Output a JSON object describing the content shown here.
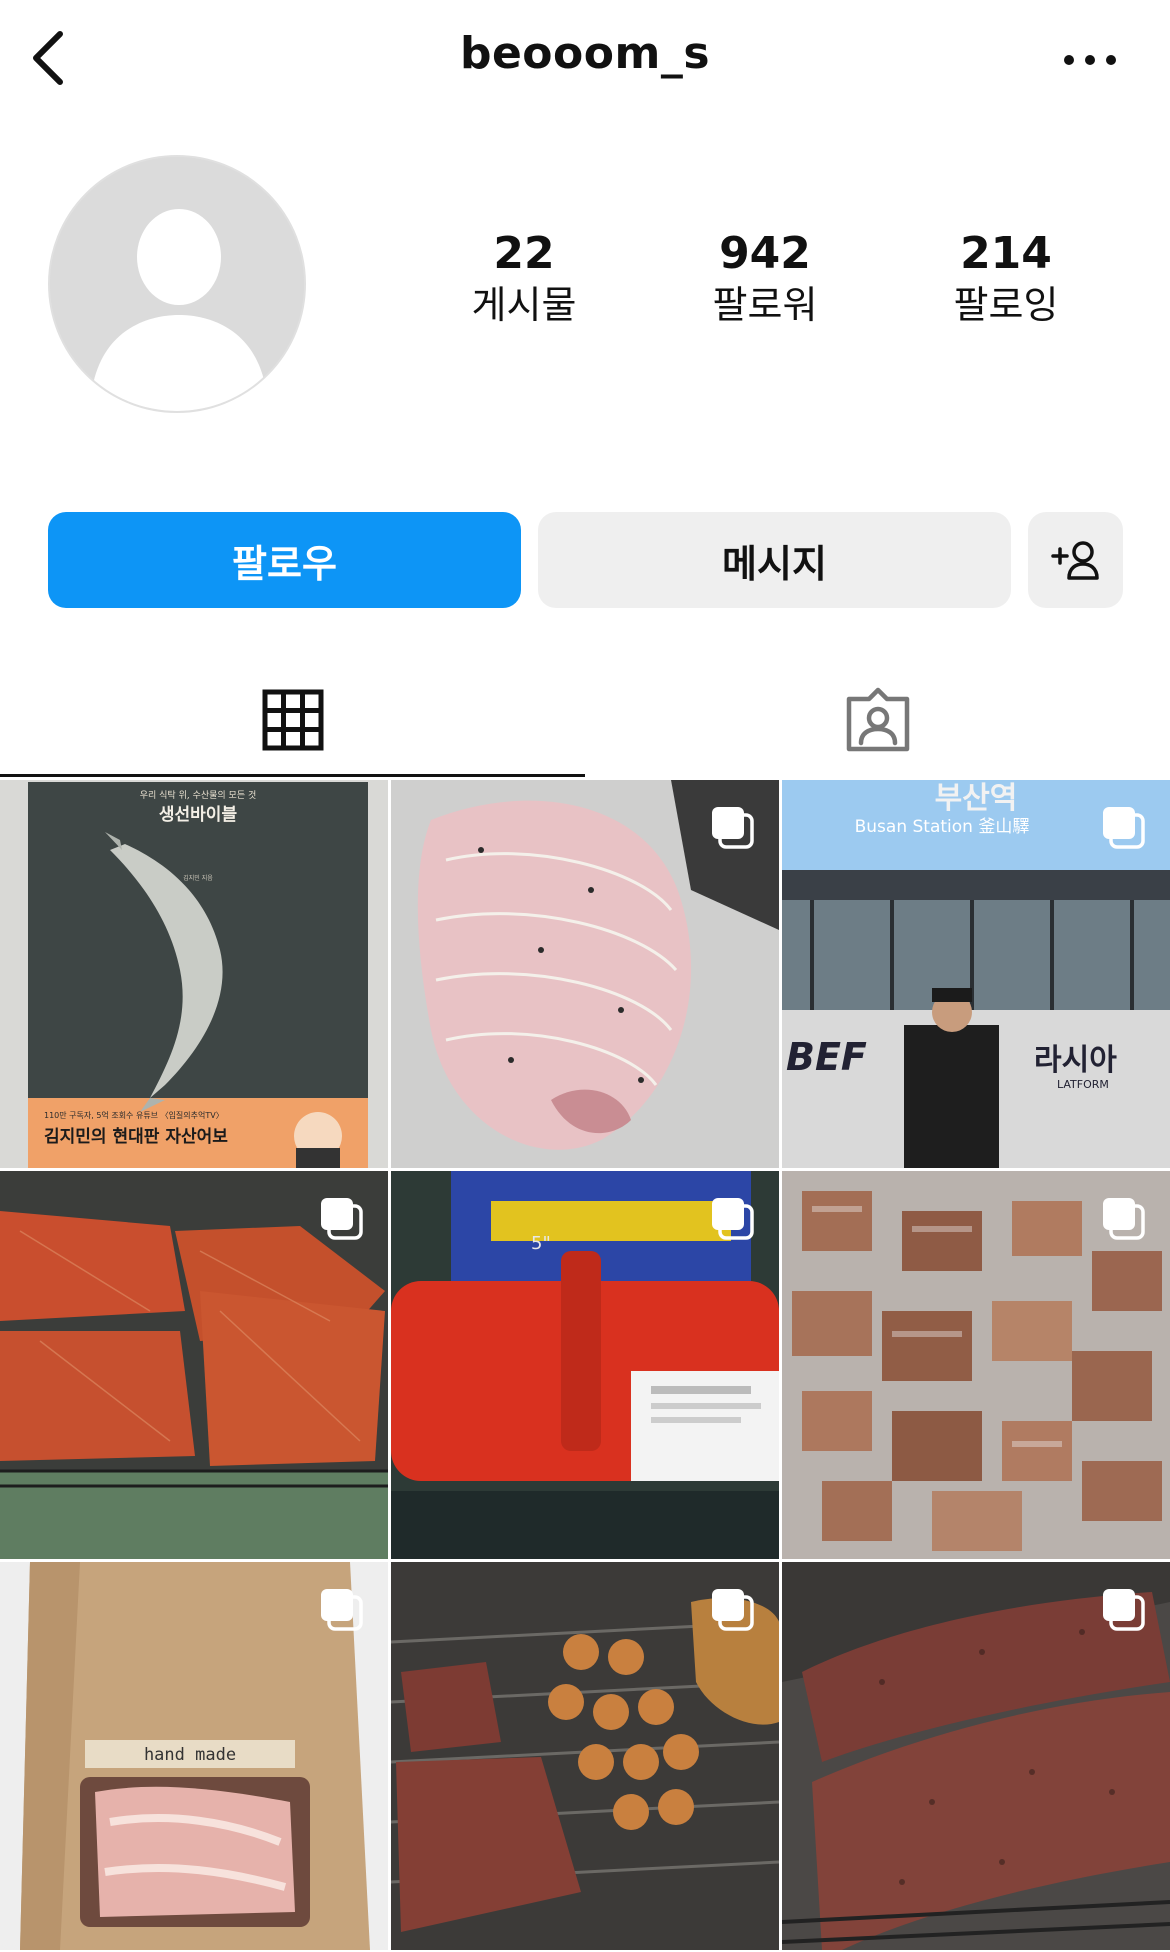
{
  "header": {
    "username": "beooom_s"
  },
  "profile": {
    "stats": [
      {
        "value": "22",
        "label": "게시물"
      },
      {
        "value": "942",
        "label": "팔로워"
      },
      {
        "value": "214",
        "label": "팔로잉"
      }
    ]
  },
  "actions": {
    "follow_label": "팔로우",
    "message_label": "메시지"
  },
  "posts": {
    "book": {
      "tagline": "우리 식탁 위, 수산물의 모든 것",
      "title": "생선바이블",
      "author": "김지민 지음",
      "blurb": "110만 구독자, 5억 조회수 유튜브 〈입질의추억TV〉",
      "subtitle": "김지민의 현대판 자산어보"
    },
    "station": {
      "sign_korean": "부산역",
      "sign_english": "Busan Station 釜山驛",
      "banner_left": "BEF",
      "banner_right": "라시아",
      "banner_bottom": "LATFORM"
    },
    "extinguisher": {
      "size_label": "5\""
    },
    "box": {
      "label": "hand made"
    }
  },
  "colors": {
    "accent_blue": "#0d95f6",
    "secondary_button": "#efefef"
  }
}
